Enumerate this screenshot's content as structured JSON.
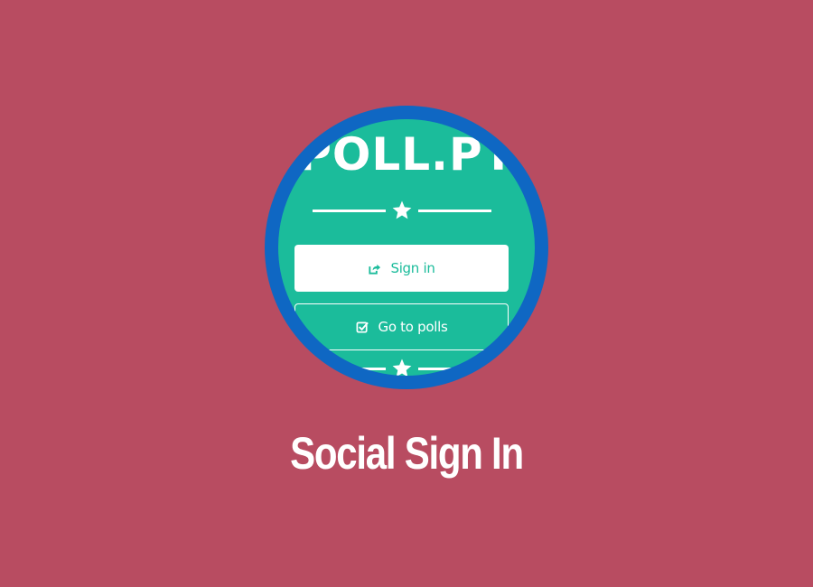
{
  "feature": {
    "title": "Social Sign In"
  },
  "app": {
    "logo_text": "POLL.PT",
    "buttons": {
      "sign_in_label": "Sign in",
      "sign_in_icon": "share-square-icon",
      "go_to_polls_label": "Go to polls",
      "go_to_polls_icon": "check-square-icon"
    },
    "divider_icon": "star-icon"
  },
  "colors": {
    "page_background": "#b84c61",
    "badge_border": "#0f67c3",
    "app_background": "#1bbc9b",
    "text_light": "#ffffff"
  }
}
